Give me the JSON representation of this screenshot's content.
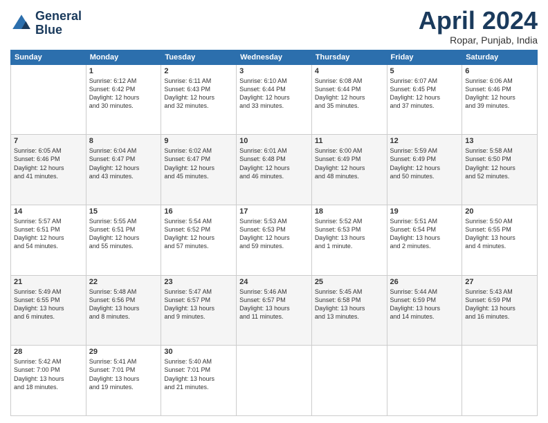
{
  "header": {
    "logo_line1": "General",
    "logo_line2": "Blue",
    "month": "April 2024",
    "location": "Ropar, Punjab, India"
  },
  "weekdays": [
    "Sunday",
    "Monday",
    "Tuesday",
    "Wednesday",
    "Thursday",
    "Friday",
    "Saturday"
  ],
  "weeks": [
    [
      {
        "day": "",
        "info": ""
      },
      {
        "day": "1",
        "info": "Sunrise: 6:12 AM\nSunset: 6:42 PM\nDaylight: 12 hours\nand 30 minutes."
      },
      {
        "day": "2",
        "info": "Sunrise: 6:11 AM\nSunset: 6:43 PM\nDaylight: 12 hours\nand 32 minutes."
      },
      {
        "day": "3",
        "info": "Sunrise: 6:10 AM\nSunset: 6:44 PM\nDaylight: 12 hours\nand 33 minutes."
      },
      {
        "day": "4",
        "info": "Sunrise: 6:08 AM\nSunset: 6:44 PM\nDaylight: 12 hours\nand 35 minutes."
      },
      {
        "day": "5",
        "info": "Sunrise: 6:07 AM\nSunset: 6:45 PM\nDaylight: 12 hours\nand 37 minutes."
      },
      {
        "day": "6",
        "info": "Sunrise: 6:06 AM\nSunset: 6:46 PM\nDaylight: 12 hours\nand 39 minutes."
      }
    ],
    [
      {
        "day": "7",
        "info": "Sunrise: 6:05 AM\nSunset: 6:46 PM\nDaylight: 12 hours\nand 41 minutes."
      },
      {
        "day": "8",
        "info": "Sunrise: 6:04 AM\nSunset: 6:47 PM\nDaylight: 12 hours\nand 43 minutes."
      },
      {
        "day": "9",
        "info": "Sunrise: 6:02 AM\nSunset: 6:47 PM\nDaylight: 12 hours\nand 45 minutes."
      },
      {
        "day": "10",
        "info": "Sunrise: 6:01 AM\nSunset: 6:48 PM\nDaylight: 12 hours\nand 46 minutes."
      },
      {
        "day": "11",
        "info": "Sunrise: 6:00 AM\nSunset: 6:49 PM\nDaylight: 12 hours\nand 48 minutes."
      },
      {
        "day": "12",
        "info": "Sunrise: 5:59 AM\nSunset: 6:49 PM\nDaylight: 12 hours\nand 50 minutes."
      },
      {
        "day": "13",
        "info": "Sunrise: 5:58 AM\nSunset: 6:50 PM\nDaylight: 12 hours\nand 52 minutes."
      }
    ],
    [
      {
        "day": "14",
        "info": "Sunrise: 5:57 AM\nSunset: 6:51 PM\nDaylight: 12 hours\nand 54 minutes."
      },
      {
        "day": "15",
        "info": "Sunrise: 5:55 AM\nSunset: 6:51 PM\nDaylight: 12 hours\nand 55 minutes."
      },
      {
        "day": "16",
        "info": "Sunrise: 5:54 AM\nSunset: 6:52 PM\nDaylight: 12 hours\nand 57 minutes."
      },
      {
        "day": "17",
        "info": "Sunrise: 5:53 AM\nSunset: 6:53 PM\nDaylight: 12 hours\nand 59 minutes."
      },
      {
        "day": "18",
        "info": "Sunrise: 5:52 AM\nSunset: 6:53 PM\nDaylight: 13 hours\nand 1 minute."
      },
      {
        "day": "19",
        "info": "Sunrise: 5:51 AM\nSunset: 6:54 PM\nDaylight: 13 hours\nand 2 minutes."
      },
      {
        "day": "20",
        "info": "Sunrise: 5:50 AM\nSunset: 6:55 PM\nDaylight: 13 hours\nand 4 minutes."
      }
    ],
    [
      {
        "day": "21",
        "info": "Sunrise: 5:49 AM\nSunset: 6:55 PM\nDaylight: 13 hours\nand 6 minutes."
      },
      {
        "day": "22",
        "info": "Sunrise: 5:48 AM\nSunset: 6:56 PM\nDaylight: 13 hours\nand 8 minutes."
      },
      {
        "day": "23",
        "info": "Sunrise: 5:47 AM\nSunset: 6:57 PM\nDaylight: 13 hours\nand 9 minutes."
      },
      {
        "day": "24",
        "info": "Sunrise: 5:46 AM\nSunset: 6:57 PM\nDaylight: 13 hours\nand 11 minutes."
      },
      {
        "day": "25",
        "info": "Sunrise: 5:45 AM\nSunset: 6:58 PM\nDaylight: 13 hours\nand 13 minutes."
      },
      {
        "day": "26",
        "info": "Sunrise: 5:44 AM\nSunset: 6:59 PM\nDaylight: 13 hours\nand 14 minutes."
      },
      {
        "day": "27",
        "info": "Sunrise: 5:43 AM\nSunset: 6:59 PM\nDaylight: 13 hours\nand 16 minutes."
      }
    ],
    [
      {
        "day": "28",
        "info": "Sunrise: 5:42 AM\nSunset: 7:00 PM\nDaylight: 13 hours\nand 18 minutes."
      },
      {
        "day": "29",
        "info": "Sunrise: 5:41 AM\nSunset: 7:01 PM\nDaylight: 13 hours\nand 19 minutes."
      },
      {
        "day": "30",
        "info": "Sunrise: 5:40 AM\nSunset: 7:01 PM\nDaylight: 13 hours\nand 21 minutes."
      },
      {
        "day": "",
        "info": ""
      },
      {
        "day": "",
        "info": ""
      },
      {
        "day": "",
        "info": ""
      },
      {
        "day": "",
        "info": ""
      }
    ]
  ]
}
